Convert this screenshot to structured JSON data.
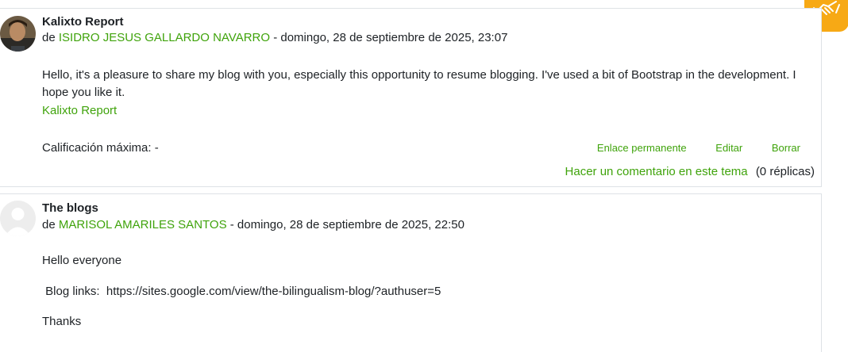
{
  "posts": [
    {
      "subject": "Kalixto Report",
      "by_prefix": "de",
      "author": "ISIDRO JESUS GALLARDO NAVARRO",
      "date": "- domingo, 28 de septiembre de 2025, 23:07",
      "message": "Hello, it's a pleasure to share my blog with you, especially this opportunity to resume blogging. I've used a bit of Bootstrap in the development. I hope you like it.",
      "link_text": "Kalixto Report",
      "rating": "Calificación máxima: -",
      "actions": {
        "permalink": "Enlace permanente",
        "edit": "Editar",
        "delete": "Borrar"
      },
      "reply_link": "Hacer un comentario en este tema",
      "reply_count": "(0 réplicas)"
    },
    {
      "subject": "The blogs",
      "by_prefix": "de",
      "author": "MARISOL AMARILES SANTOS",
      "date": "- domingo, 28 de septiembre de 2025, 22:50",
      "line1": "Hello everyone",
      "line2": " Blog links:  https://sites.google.com/view/the-bilingualism-blog/?authuser=5",
      "line3": "Thanks"
    }
  ],
  "colors": {
    "accent": "#3fa30b",
    "fab": "#f7a915",
    "border": "#dee2e6"
  },
  "fab_icon": "handshake-icon"
}
